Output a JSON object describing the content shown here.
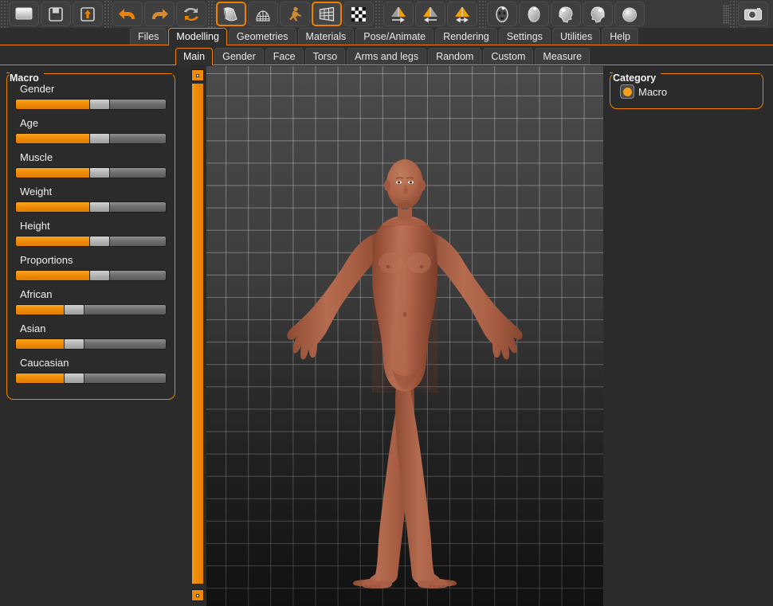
{
  "toolbar": {
    "groups": [
      {
        "buttons": [
          {
            "name": "new-button",
            "icon": "new-document-icon",
            "selected": false
          },
          {
            "name": "save-button",
            "icon": "floppy-disk-icon",
            "selected": false
          },
          {
            "name": "load-button",
            "icon": "load-arrow-up-icon",
            "selected": false
          }
        ]
      },
      {
        "buttons": [
          {
            "name": "undo-button",
            "icon": "undo-arrow-icon",
            "selected": false
          },
          {
            "name": "redo-button",
            "icon": "redo-arrow-icon",
            "selected": false
          },
          {
            "name": "reset-mesh-button",
            "icon": "reset-circular-arrows-icon",
            "selected": false
          }
        ]
      },
      {
        "buttons": [
          {
            "name": "smooth-button",
            "icon": "smooth-shading-icon",
            "selected": true
          },
          {
            "name": "wireframe-button",
            "icon": "wireframe-globe-icon",
            "selected": false
          },
          {
            "name": "pose-button",
            "icon": "pose-figure-icon",
            "selected": false
          },
          {
            "name": "subdivide-button",
            "icon": "grid-mesh-icon",
            "selected": true
          },
          {
            "name": "background-button",
            "icon": "checkerboard-icon",
            "selected": false
          }
        ]
      },
      {
        "buttons": [
          {
            "name": "symmetry-right-button",
            "icon": "symmetry-right-icon",
            "selected": false
          },
          {
            "name": "symmetry-left-button",
            "icon": "symmetry-left-icon",
            "selected": false
          },
          {
            "name": "symmetry-both-button",
            "icon": "symmetry-both-icon",
            "selected": false
          }
        ]
      },
      {
        "buttons": [
          {
            "name": "front-view-button",
            "icon": "face-front-view-icon",
            "selected": false
          },
          {
            "name": "back-view-button",
            "icon": "head-back-view-icon",
            "selected": false
          },
          {
            "name": "left-view-button",
            "icon": "head-left-view-icon",
            "selected": false
          },
          {
            "name": "right-view-button",
            "icon": "head-right-view-icon",
            "selected": false
          },
          {
            "name": "top-view-button",
            "icon": "head-top-view-icon",
            "selected": false
          }
        ]
      },
      {
        "buttons": [
          {
            "name": "grab-screen-button",
            "icon": "camera-grab-icon",
            "selected": false
          }
        ]
      }
    ]
  },
  "main_tabs": {
    "items": [
      {
        "label": "Files",
        "active": false
      },
      {
        "label": "Modelling",
        "active": true
      },
      {
        "label": "Geometries",
        "active": false
      },
      {
        "label": "Materials",
        "active": false
      },
      {
        "label": "Pose/Animate",
        "active": false
      },
      {
        "label": "Rendering",
        "active": false
      },
      {
        "label": "Settings",
        "active": false
      },
      {
        "label": "Utilities",
        "active": false
      },
      {
        "label": "Help",
        "active": false
      }
    ]
  },
  "sub_tabs": {
    "items": [
      {
        "label": "Main",
        "active": true
      },
      {
        "label": "Gender",
        "active": false
      },
      {
        "label": "Face",
        "active": false
      },
      {
        "label": "Torso",
        "active": false
      },
      {
        "label": "Arms and legs",
        "active": false
      },
      {
        "label": "Random",
        "active": false
      },
      {
        "label": "Custom",
        "active": false
      },
      {
        "label": "Measure",
        "active": false
      }
    ]
  },
  "left_panel": {
    "group_title": "Macro",
    "sliders": [
      {
        "label": "Gender",
        "value": 50
      },
      {
        "label": "Age",
        "value": 50
      },
      {
        "label": "Muscle",
        "value": 50
      },
      {
        "label": "Weight",
        "value": 50
      },
      {
        "label": "Height",
        "value": 50
      },
      {
        "label": "Proportions",
        "value": 50
      },
      {
        "label": "African",
        "value": 33
      },
      {
        "label": "Asian",
        "value": 33
      },
      {
        "label": "Caucasian",
        "value": 33
      }
    ]
  },
  "right_panel": {
    "group_title": "Category",
    "options": [
      {
        "label": "Macro",
        "selected": true
      }
    ]
  },
  "viewport": {
    "scrollbar": {
      "up_button": "scroll-up-button",
      "down_button": "scroll-down-button",
      "thumb": "scroll-thumb"
    },
    "model": "human-body-mesh"
  },
  "colors": {
    "accent": "#f08000",
    "panel_bg": "#2b2b2b",
    "toolbar_bg": "#3a3a3a",
    "skin": "#b06548",
    "viewport_bg": "#434343",
    "grid_line": "#bebebe"
  }
}
